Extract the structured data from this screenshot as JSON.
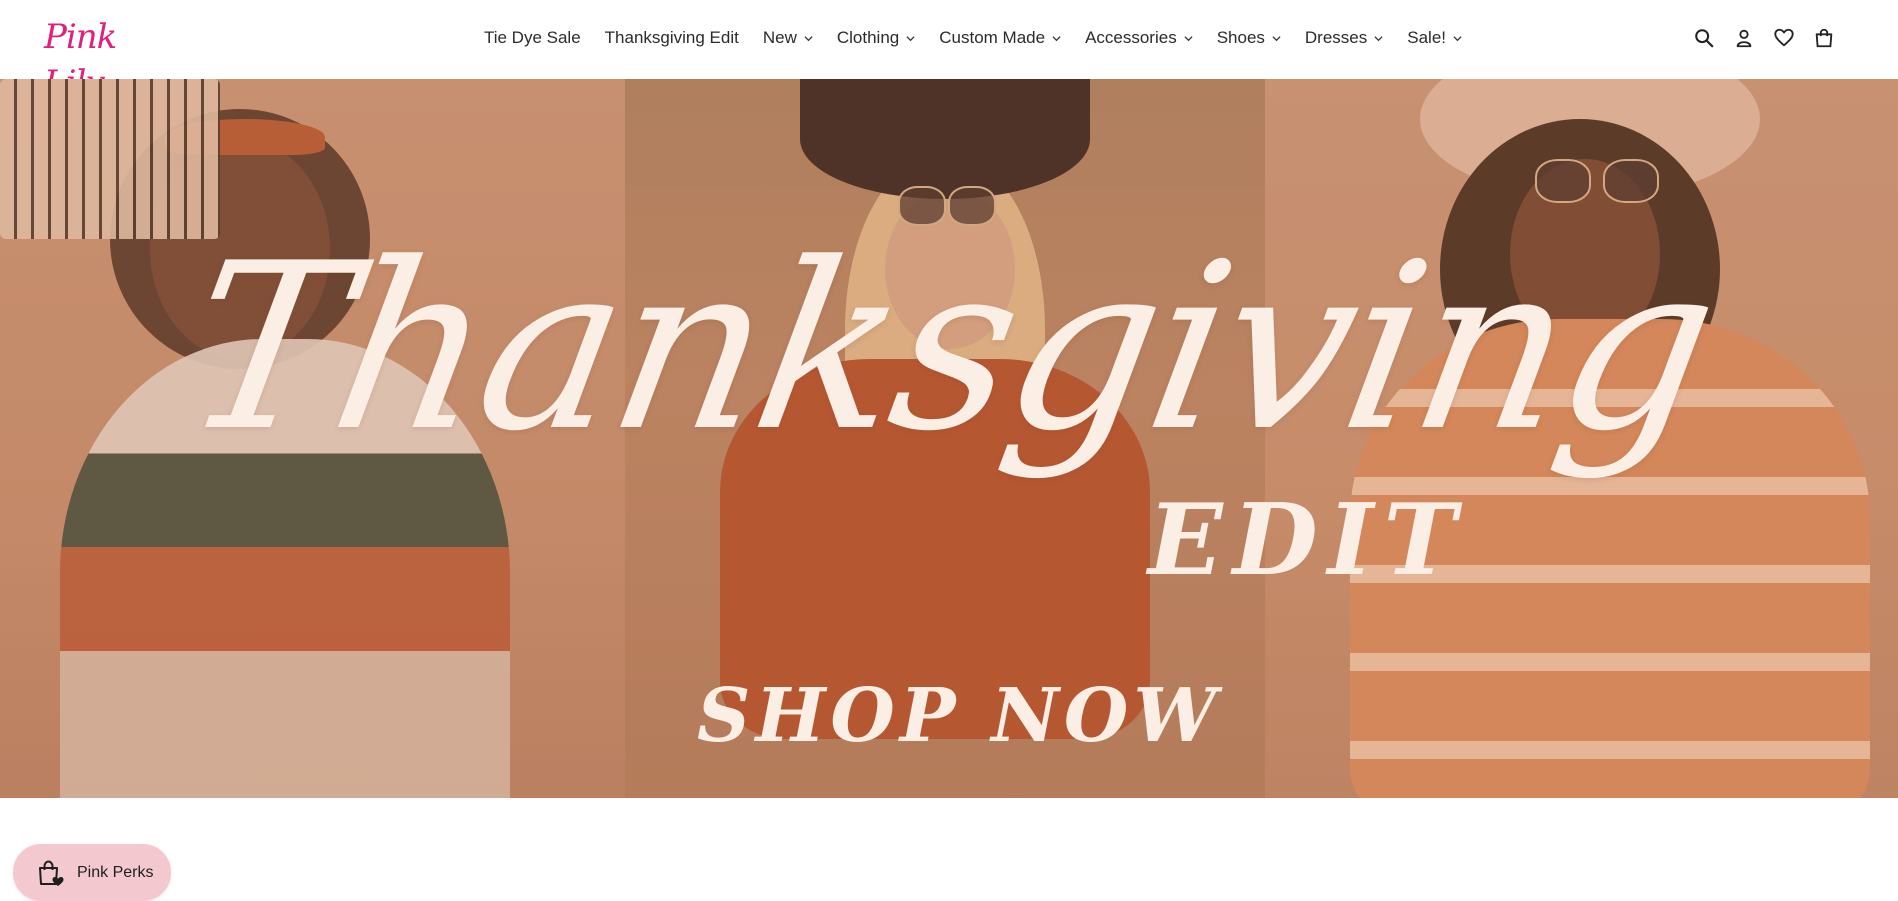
{
  "header": {
    "logo_text": "Pink Lily",
    "nav": [
      {
        "label": "Tie Dye Sale",
        "has_dropdown": false
      },
      {
        "label": "Thanksgiving Edit",
        "has_dropdown": false
      },
      {
        "label": "New",
        "has_dropdown": true
      },
      {
        "label": "Clothing",
        "has_dropdown": true
      },
      {
        "label": "Custom Made",
        "has_dropdown": true
      },
      {
        "label": "Accessories",
        "has_dropdown": true
      },
      {
        "label": "Shoes",
        "has_dropdown": true
      },
      {
        "label": "Dresses",
        "has_dropdown": true
      },
      {
        "label": "Sale!",
        "has_dropdown": true
      }
    ],
    "icons": [
      "search-icon",
      "account-icon",
      "wishlist-heart-icon",
      "cart-bag-icon"
    ]
  },
  "hero": {
    "script_title": "Thanksgiving",
    "subtitle": "EDIT",
    "cta": "SHOP NOW"
  },
  "perks_widget": {
    "label": "Pink Perks",
    "icon": "shopping-bag-heart-icon"
  },
  "colors": {
    "brand_pink": "#e0207f",
    "hero_text": "#fbeee4",
    "perks_bg": "#f3c9cf"
  }
}
